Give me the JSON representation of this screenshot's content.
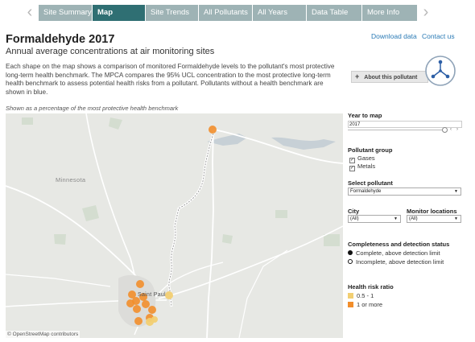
{
  "tabs": [
    {
      "label": "Site Summary"
    },
    {
      "label": "Map"
    },
    {
      "label": "Site Trends"
    },
    {
      "label": "All Pollutants"
    },
    {
      "label": "All Years"
    },
    {
      "label": "Data Table"
    },
    {
      "label": "More Info"
    }
  ],
  "active_tab": "Map",
  "header": {
    "title": "Formaldehyde 2017",
    "subtitle": "Annual average concentrations at air monitoring sites",
    "download_link": "Download data",
    "contact_link": "Contact us",
    "description": "Each shape on the map shows a comparison of monitored Formaldehyde levels to the pollutant's most protective long-term health benchmark. The MPCA compares the 95% UCL concentration to the most protective long-term health benchmark to assess potential health risks from a pollutant. Pollutants without a health benchmark are shown in blue.",
    "about_button": "About this pollutant",
    "caption": "Shown as a percentage of the most protective health benchmark"
  },
  "map": {
    "place_labels": [
      "Minnesota",
      "Saint Paul"
    ],
    "attribution": "© OpenStreetMap contributors"
  },
  "panel": {
    "year_label": "Year to map",
    "year_value": "2017",
    "pollutant_group_label": "Pollutant group",
    "groups": [
      {
        "label": "Gases",
        "checked": true
      },
      {
        "label": "Metals",
        "checked": true
      }
    ],
    "select_pollutant_label": "Select pollutant",
    "pollutant_value": "Formaldehyde",
    "city_label": "City",
    "city_value": "(All)",
    "monitor_label": "Monitor locations",
    "monitor_value": "(All)",
    "completeness_label": "Completeness and detection status",
    "completeness_items": [
      "Complete, above detection limit",
      "Incomplete, above detection limit"
    ],
    "risk_label": "Health risk ratio",
    "risk_items": [
      {
        "label": "0.5 - 1",
        "color": "#f2cf72"
      },
      {
        "label": "1 or more",
        "color": "#f28e2b"
      }
    ]
  },
  "colors": {
    "active_tab": "#2f6f73",
    "inactive_tab": "#9eb3b5",
    "link": "#2a7ab5",
    "map_background": "#e7e8e4",
    "water": "#c7d0d6",
    "park": "#d4ddd0"
  },
  "icons": [
    "chevron-left-icon",
    "chevron-right-icon",
    "plus-icon",
    "mpca-logo-icon",
    "checkbox-icon",
    "dropdown-arrow-icon"
  ]
}
